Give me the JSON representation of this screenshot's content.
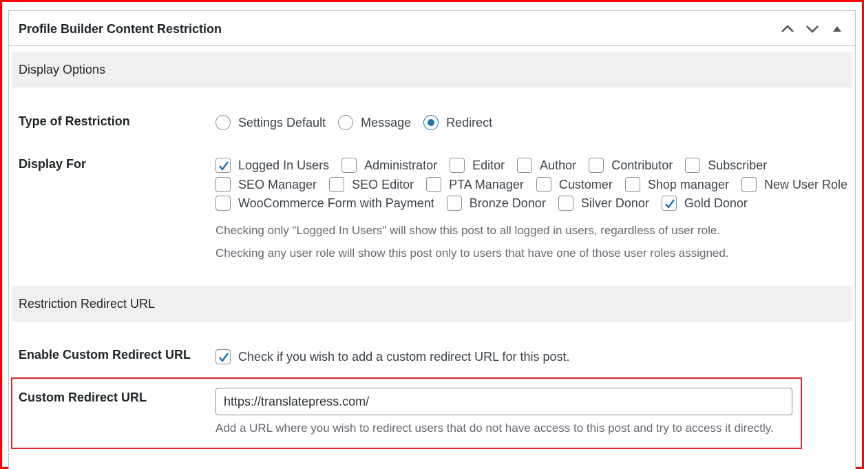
{
  "metabox": {
    "title": "Profile Builder Content Restriction"
  },
  "sections": {
    "display_options": "Display Options",
    "redirect_url": "Restriction Redirect URL"
  },
  "restriction_type": {
    "label": "Type of Restriction",
    "options": [
      "Settings Default",
      "Message",
      "Redirect"
    ],
    "selected": "Redirect"
  },
  "display_for": {
    "label": "Display For",
    "rows": [
      [
        {
          "label": "Logged In Users",
          "checked": true
        },
        {
          "label": "Administrator",
          "checked": false
        },
        {
          "label": "Editor",
          "checked": false
        },
        {
          "label": "Author",
          "checked": false
        },
        {
          "label": "Contributor",
          "checked": false
        },
        {
          "label": "Subscriber",
          "checked": false
        }
      ],
      [
        {
          "label": "SEO Manager",
          "checked": false
        },
        {
          "label": "SEO Editor",
          "checked": false
        },
        {
          "label": "PTA Manager",
          "checked": false
        },
        {
          "label": "Customer",
          "checked": false
        },
        {
          "label": "Shop manager",
          "checked": false
        },
        {
          "label": "New User Role",
          "checked": false
        }
      ],
      [
        {
          "label": "WooCommerce Form with Payment",
          "checked": false
        },
        {
          "label": "Bronze Donor",
          "checked": false
        },
        {
          "label": "Silver Donor",
          "checked": false
        },
        {
          "label": "Gold Donor",
          "checked": true
        }
      ]
    ],
    "desc1": "Checking only \"Logged In Users\" will show this post to all logged in users, regardless of user role.",
    "desc2": "Checking any user role will show this post only to users that have one of those user roles assigned."
  },
  "enable_custom_redirect": {
    "label": "Enable Custom Redirect URL",
    "checkbox_label": "Check if you wish to add a custom redirect URL for this post.",
    "checked": true
  },
  "custom_redirect": {
    "label": "Custom Redirect URL",
    "value": "https://translatepress.com/",
    "description": "Add a URL where you wish to redirect users that do not have access to this post and try to access it directly."
  },
  "colors": {
    "accent": "#2271b1",
    "highlight": "#e0262c",
    "frame": "#ff0000"
  }
}
